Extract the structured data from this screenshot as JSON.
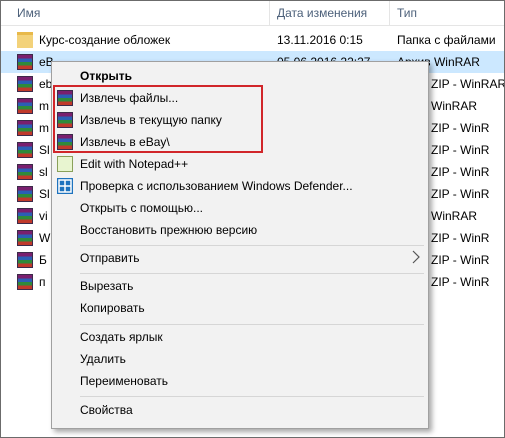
{
  "header": {
    "name": "Имя",
    "date": "Дата изменения",
    "type": "Тип"
  },
  "files": [
    {
      "name": "Курс-создание обложек",
      "date": "13.11.2016 0:15",
      "type": "Папка с файлами",
      "icon": "folder-icon"
    },
    {
      "name": "eB",
      "date": "05.06.2016 22:27",
      "type": "Архив WinRAR",
      "icon": "winrar-icon"
    },
    {
      "name": "eb",
      "date": "",
      "type": "ZIP - WinRAR",
      "icon": "winrar-icon"
    },
    {
      "name": "m",
      "date": "",
      "type": "WinRAR",
      "icon": "winrar-icon"
    },
    {
      "name": "m",
      "date": "",
      "type": "ZIP - WinR",
      "icon": "winrar-icon"
    },
    {
      "name": "Sl",
      "date": "",
      "type": "ZIP - WinR",
      "icon": "winrar-icon"
    },
    {
      "name": "sl",
      "date": "",
      "type": "ZIP - WinR",
      "icon": "winrar-icon"
    },
    {
      "name": "Sl",
      "date": "",
      "type": "ZIP - WinR",
      "icon": "winrar-icon"
    },
    {
      "name": "vi",
      "date": "",
      "type": "WinRAR",
      "icon": "winrar-icon"
    },
    {
      "name": "W",
      "date": "",
      "type": "ZIP - WinR",
      "icon": "winrar-icon"
    },
    {
      "name": "Б",
      "date": "",
      "type": "ZIP - WinR",
      "icon": "winrar-icon"
    },
    {
      "name": "п",
      "date": "",
      "type": "ZIP - WinR",
      "icon": "winrar-icon"
    }
  ],
  "menu": {
    "open": "Открыть",
    "extract_files": "Извлечь файлы...",
    "extract_here": "Извлечь в текущую папку",
    "extract_to": "Извлечь в eBay\\",
    "notepad": "Edit with Notepad++",
    "defender": "Проверка с использованием Windows Defender...",
    "open_with": "Открыть с помощью...",
    "restore": "Восстановить прежнюю версию",
    "send_to": "Отправить",
    "cut": "Вырезать",
    "copy": "Копировать",
    "shortcut": "Создать ярлык",
    "delete": "Удалить",
    "rename": "Переименовать",
    "properties": "Свойства"
  },
  "colors": {
    "highlight_border": "#d1262a",
    "selection": "#cce8ff",
    "header_text": "#4c607a"
  }
}
